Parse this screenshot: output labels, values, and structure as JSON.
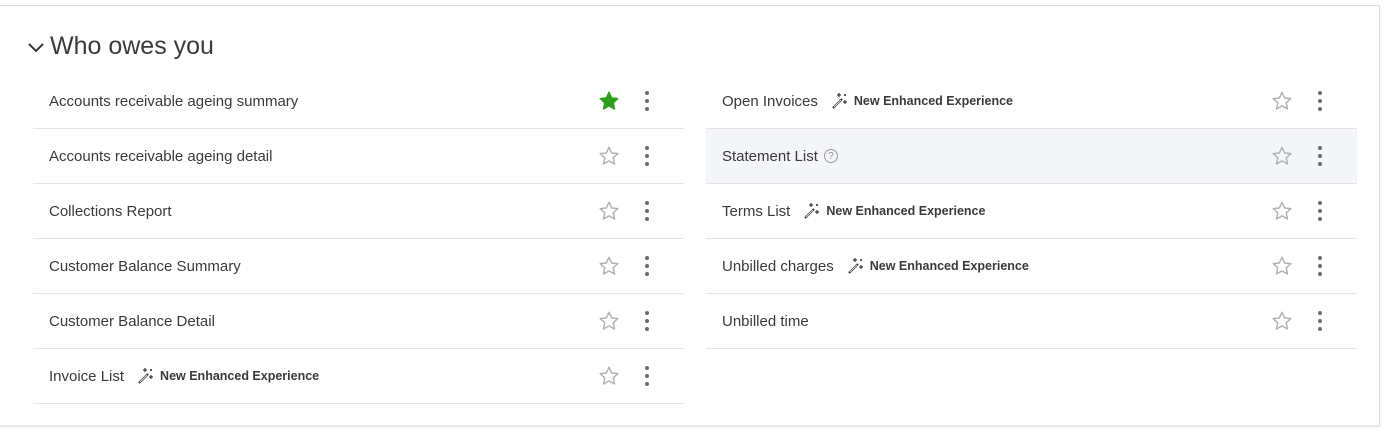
{
  "section": {
    "title": "Who owes you",
    "expanded": true
  },
  "badge_label": "New Enhanced Experience",
  "colors": {
    "favorite": "#2ca01c",
    "star_outline": "#b0b2b8",
    "hover_row": "#f4f5f8"
  },
  "left_reports": [
    {
      "name": "Accounts receivable ageing summary",
      "favorite": true,
      "badge": false
    },
    {
      "name": "Accounts receivable ageing detail",
      "favorite": false,
      "badge": false
    },
    {
      "name": "Collections Report",
      "favorite": false,
      "badge": false
    },
    {
      "name": "Customer Balance Summary",
      "favorite": false,
      "badge": false
    },
    {
      "name": "Customer Balance Detail",
      "favorite": false,
      "badge": false
    },
    {
      "name": "Invoice List",
      "favorite": false,
      "badge": true
    }
  ],
  "right_reports": [
    {
      "name": "Open Invoices",
      "favorite": false,
      "badge": true
    },
    {
      "name": "Statement List",
      "favorite": false,
      "badge": false,
      "help": "?",
      "highlighted": true
    },
    {
      "name": "Terms List",
      "favorite": false,
      "badge": true
    },
    {
      "name": "Unbilled charges",
      "favorite": false,
      "badge": true
    },
    {
      "name": "Unbilled time",
      "favorite": false,
      "badge": false
    }
  ]
}
